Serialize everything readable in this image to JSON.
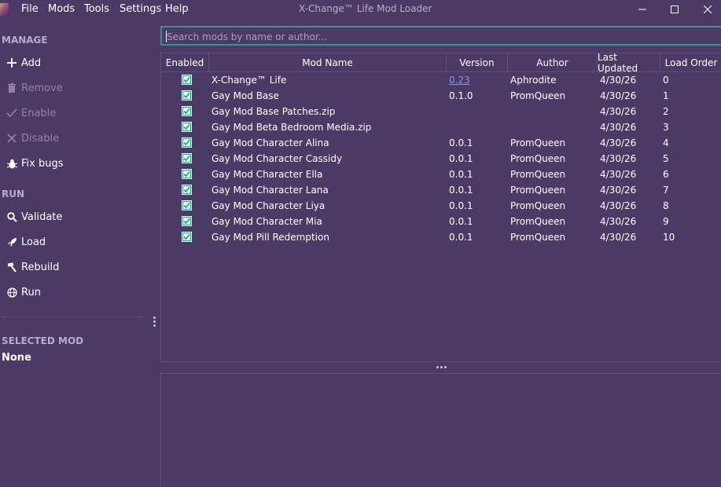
{
  "window": {
    "title": "X-Change™ Life Mod Loader",
    "menu": [
      "File",
      "Mods",
      "Tools",
      "Settings",
      "Help"
    ]
  },
  "sidebar": {
    "manage_label": "MANAGE",
    "manage_items": [
      {
        "label": "Add",
        "icon": "plus-icon",
        "enabled": true
      },
      {
        "label": "Remove",
        "icon": "trash-icon",
        "enabled": false
      },
      {
        "label": "Enable",
        "icon": "check-icon",
        "enabled": false
      },
      {
        "label": "Disable",
        "icon": "x-icon",
        "enabled": false
      },
      {
        "label": "Fix bugs",
        "icon": "bug-icon",
        "enabled": true
      }
    ],
    "run_label": "RUN",
    "run_items": [
      {
        "label": "Validate",
        "icon": "magnifier-icon"
      },
      {
        "label": "Load",
        "icon": "rocket-icon"
      },
      {
        "label": "Rebuild",
        "icon": "hammer-icon"
      },
      {
        "label": "Run",
        "icon": "globe-icon"
      }
    ],
    "selected_label": "SELECTED MOD",
    "selected_value": "None"
  },
  "search": {
    "placeholder": "Search mods by name or author...",
    "value": ""
  },
  "table": {
    "columns": [
      "Enabled",
      "Mod Name",
      "Version",
      "Author",
      "Last Updated",
      "Load Order"
    ],
    "rows": [
      {
        "enabled": true,
        "name": "X-Change™ Life",
        "version": "0.23",
        "version_link": true,
        "author": "Aphrodite",
        "updated": "4/30/26",
        "order": "0"
      },
      {
        "enabled": true,
        "name": "Gay Mod Base",
        "version": "0.1.0",
        "author": "PromQueen",
        "updated": "4/30/26",
        "order": "1"
      },
      {
        "enabled": true,
        "name": "Gay Mod Base Patches.zip",
        "version": "",
        "author": "",
        "updated": "4/30/26",
        "order": "2"
      },
      {
        "enabled": true,
        "name": "Gay Mod Beta Bedroom Media.zip",
        "version": "",
        "author": "",
        "updated": "4/30/26",
        "order": "3"
      },
      {
        "enabled": true,
        "name": "Gay Mod Character Alina",
        "version": "0.0.1",
        "author": "PromQueen",
        "updated": "4/30/26",
        "order": "4"
      },
      {
        "enabled": true,
        "name": "Gay Mod Character Cassidy",
        "version": "0.0.1",
        "author": "PromQueen",
        "updated": "4/30/26",
        "order": "5"
      },
      {
        "enabled": true,
        "name": "Gay Mod Character Ella",
        "version": "0.0.1",
        "author": "PromQueen",
        "updated": "4/30/26",
        "order": "6"
      },
      {
        "enabled": true,
        "name": "Gay Mod Character Lana",
        "version": "0.0.1",
        "author": "PromQueen",
        "updated": "4/30/26",
        "order": "7"
      },
      {
        "enabled": true,
        "name": "Gay Mod Character Liya",
        "version": "0.0.1",
        "author": "PromQueen",
        "updated": "4/30/26",
        "order": "8"
      },
      {
        "enabled": true,
        "name": "Gay Mod Character Mia",
        "version": "0.0.1",
        "author": "PromQueen",
        "updated": "4/30/26",
        "order": "9"
      },
      {
        "enabled": true,
        "name": "Gay Mod Pill Redemption",
        "version": "0.0.1",
        "author": "PromQueen",
        "updated": "4/30/26",
        "order": "10"
      }
    ]
  },
  "colors": {
    "background": "#4b3a66",
    "accent": "#3f8f8f",
    "checkbox": "#2aa57a",
    "link": "#6fa0e8",
    "muted_text": "#b7accb"
  }
}
